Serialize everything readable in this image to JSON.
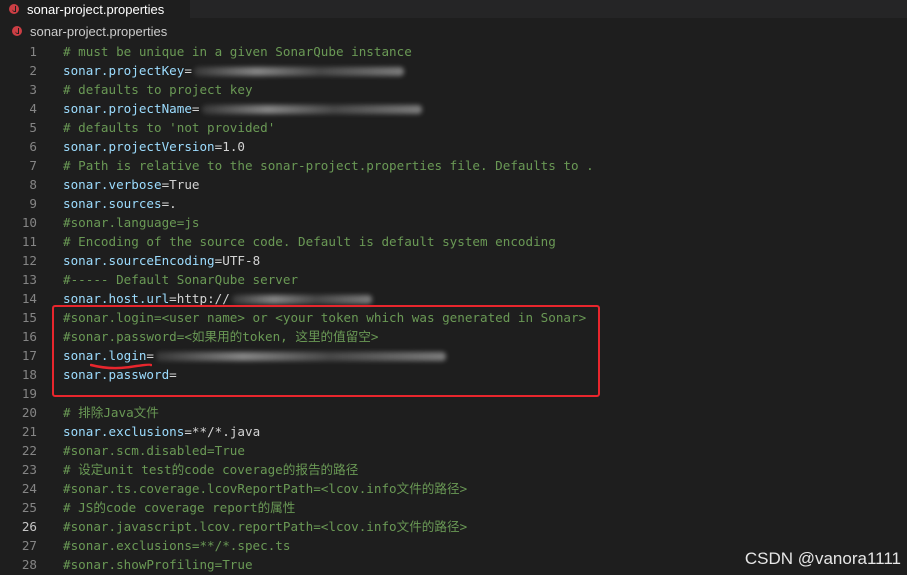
{
  "tab": {
    "title": "sonar-project.properties"
  },
  "breadcrumb": {
    "file": "sonar-project.properties"
  },
  "lines": [
    {
      "n": "1",
      "type": "comment",
      "text": "# must be unique in a given SonarQube instance"
    },
    {
      "n": "2",
      "type": "kv",
      "key": "sonar.projectKey",
      "value": "",
      "blurred": true,
      "blurWidth": 210
    },
    {
      "n": "3",
      "type": "comment",
      "text": "# defaults to project key"
    },
    {
      "n": "4",
      "type": "kv",
      "key": "sonar.projectName",
      "value": "",
      "blurred": true,
      "blurWidth": 220
    },
    {
      "n": "5",
      "type": "comment",
      "text": "# defaults to 'not provided'"
    },
    {
      "n": "6",
      "type": "kv",
      "key": "sonar.projectVersion",
      "value": "1.0"
    },
    {
      "n": "7",
      "type": "comment",
      "text": "# Path is relative to the sonar-project.properties file. Defaults to ."
    },
    {
      "n": "8",
      "type": "kv",
      "key": "sonar.verbose",
      "value": "True"
    },
    {
      "n": "9",
      "type": "kv",
      "key": "sonar.sources",
      "value": "."
    },
    {
      "n": "10",
      "type": "comment",
      "text": "#sonar.language=js"
    },
    {
      "n": "11",
      "type": "comment",
      "text": "# Encoding of the source code. Default is default system encoding"
    },
    {
      "n": "12",
      "type": "kv",
      "key": "sonar.sourceEncoding",
      "value": "UTF-8"
    },
    {
      "n": "13",
      "type": "comment",
      "text": "#----- Default SonarQube server"
    },
    {
      "n": "14",
      "type": "kv",
      "key": "sonar.host.url",
      "value": "http://",
      "blurred": true,
      "blurWidth": 140
    },
    {
      "n": "15",
      "type": "comment",
      "text": "#sonar.login=<user name> or <your token which was generated in Sonar>"
    },
    {
      "n": "16",
      "type": "comment",
      "text": "#sonar.password=<如果用的token, 这里的值留空>"
    },
    {
      "n": "17",
      "type": "kv",
      "key": "sonar.login",
      "value": "",
      "blurred": true,
      "blurWidth": 290
    },
    {
      "n": "18",
      "type": "kv",
      "key": "sonar.password",
      "value": ""
    },
    {
      "n": "19",
      "type": "empty",
      "text": ""
    },
    {
      "n": "20",
      "type": "comment",
      "text": "# 排除Java文件"
    },
    {
      "n": "21",
      "type": "kv",
      "key": "sonar.exclusions",
      "value": "**/*.java"
    },
    {
      "n": "22",
      "type": "comment",
      "text": "#sonar.scm.disabled=True"
    },
    {
      "n": "23",
      "type": "comment",
      "text": "# 设定unit test的code coverage的报告的路径"
    },
    {
      "n": "24",
      "type": "comment",
      "text": "#sonar.ts.coverage.lcovReportPath=<lcov.info文件的路径>"
    },
    {
      "n": "25",
      "type": "comment",
      "text": "# JS的code coverage report的属性"
    },
    {
      "n": "26",
      "type": "comment",
      "text": "#sonar.javascript.lcov.reportPath=<lcov.info文件的路径>",
      "active": true
    },
    {
      "n": "27",
      "type": "comment",
      "text": "#sonar.exclusions=**/*.spec.ts"
    },
    {
      "n": "28",
      "type": "comment",
      "text": "#sonar.showProfiling=True"
    }
  ],
  "watermark": "CSDN @vanora1111",
  "colors": {
    "background": "#1e1e1e",
    "comment": "#6a9955",
    "key": "#9cdcfe",
    "annotation": "#e8262d"
  }
}
